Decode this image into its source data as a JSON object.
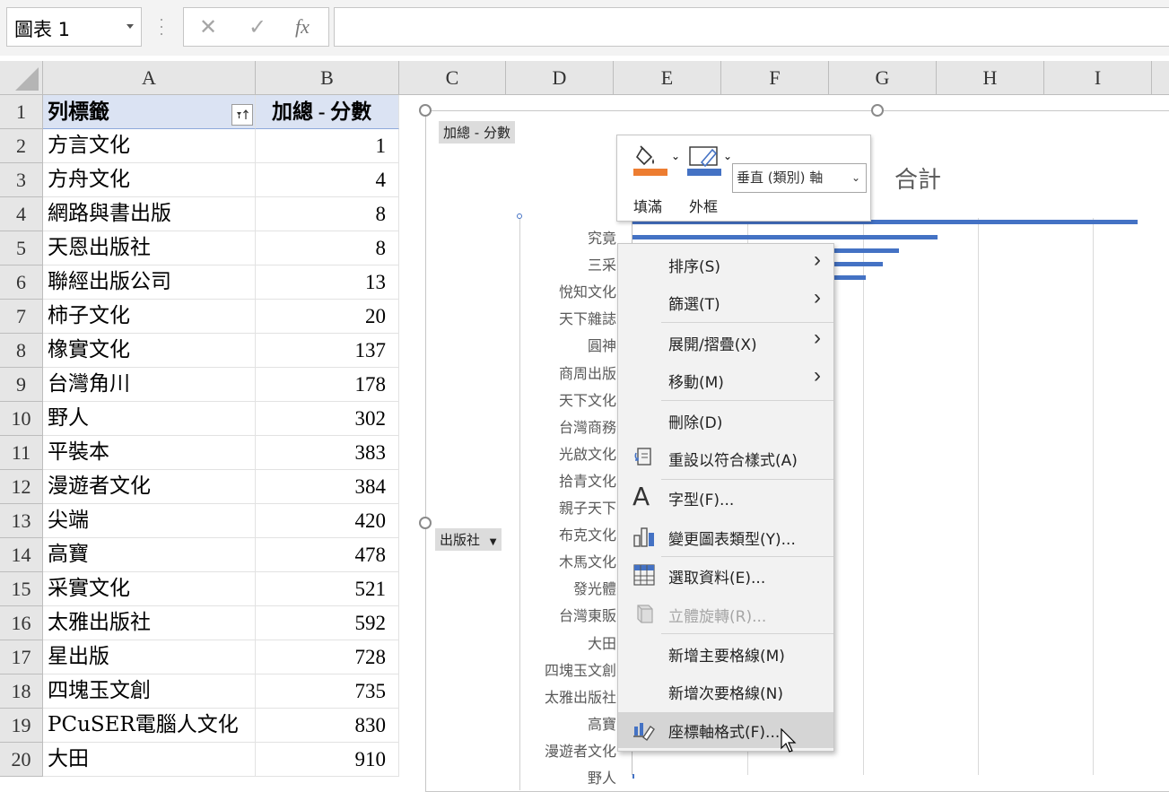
{
  "name_box": "圖表 1",
  "formula_icons": {
    "cancel": "✕",
    "enter": "✓",
    "fx": "fx"
  },
  "columns": [
    "A",
    "B",
    "C",
    "D",
    "E",
    "F",
    "G",
    "H",
    "I"
  ],
  "rows": [
    {
      "num": "1",
      "a": "列標籤",
      "b": "加總 - 分數"
    },
    {
      "num": "2",
      "a": "方言文化",
      "b": "1"
    },
    {
      "num": "3",
      "a": "方舟文化",
      "b": "4"
    },
    {
      "num": "4",
      "a": "網路與書出版",
      "b": "8"
    },
    {
      "num": "5",
      "a": "天恩出版社",
      "b": "8"
    },
    {
      "num": "6",
      "a": "聯經出版公司",
      "b": "13"
    },
    {
      "num": "7",
      "a": "柿子文化",
      "b": "20"
    },
    {
      "num": "8",
      "a": "橡實文化",
      "b": "137"
    },
    {
      "num": "9",
      "a": "台灣角川",
      "b": "178"
    },
    {
      "num": "10",
      "a": "野人",
      "b": "302"
    },
    {
      "num": "11",
      "a": "平裝本",
      "b": "383"
    },
    {
      "num": "12",
      "a": "漫遊者文化",
      "b": "384"
    },
    {
      "num": "13",
      "a": "尖端",
      "b": "420"
    },
    {
      "num": "14",
      "a": "高寶",
      "b": "478"
    },
    {
      "num": "15",
      "a": "采實文化",
      "b": "521"
    },
    {
      "num": "16",
      "a": "太雅出版社",
      "b": "592"
    },
    {
      "num": "17",
      "a": "星出版",
      "b": "728"
    },
    {
      "num": "18",
      "a": "四塊玉文創",
      "b": "735"
    },
    {
      "num": "19",
      "a": "PCuSER電腦人文化",
      "b": "830"
    },
    {
      "num": "20",
      "a": "大田",
      "b": "910"
    }
  ],
  "chart": {
    "value_field_button": "加總 - 分數",
    "axis_field_button": "出版社",
    "title": "合計",
    "category_labels": [
      "究竟",
      "三采",
      "悅知文化",
      "天下雜誌",
      "圓神",
      "商周出版",
      "天下文化",
      "台灣商務",
      "光啟文化",
      "拾青文化",
      "親子天下",
      "布克文化",
      "木馬文化",
      "發光體",
      "台灣東販",
      "大田",
      "四塊玉文創",
      "太雅出版社",
      "高寶",
      "漫遊者文化",
      "野人"
    ]
  },
  "chart_data": {
    "type": "bar",
    "orientation": "horizontal",
    "title": "合計",
    "categories": [
      "究竟",
      "三采",
      "悅知文化",
      "天下雜誌",
      "圓神",
      "商周出版",
      "天下文化",
      "台灣商務",
      "光啟文化",
      "拾青文化",
      "親子天下",
      "布克文化",
      "木馬文化",
      "發光體",
      "台灣東販",
      "大田",
      "四塊玉文創",
      "太雅出版社",
      "高寶",
      "漫遊者文化",
      "野人"
    ],
    "values": [
      4400,
      2660,
      2320,
      2180,
      2030,
      null,
      null,
      null,
      null,
      null,
      null,
      null,
      null,
      null,
      null,
      910,
      735,
      592,
      478,
      384,
      302
    ],
    "color": "#4472c4",
    "grid": true
  },
  "mini_toolbar": {
    "fill_label": "填滿",
    "outline_label": "外框",
    "element_select": "垂直 (類別) 軸",
    "fill_color": "#ed7d31",
    "outline_color": "#4472c4"
  },
  "context_menu": {
    "items": [
      {
        "label": "排序(S)",
        "submenu": true
      },
      {
        "label": "篩選(T)",
        "submenu": true
      },
      {
        "label": "展開/摺疊(X)",
        "submenu": true
      },
      {
        "label": "移動(M)",
        "submenu": true
      },
      {
        "label": "刪除(D)"
      },
      {
        "label": "重設以符合樣式(A)",
        "icon": "reset-style-icon"
      },
      {
        "label": "字型(F)...",
        "icon": "font-icon"
      },
      {
        "label": "變更圖表類型(Y)...",
        "icon": "chart-type-icon"
      },
      {
        "label": "選取資料(E)...",
        "icon": "select-data-icon"
      },
      {
        "label": "立體旋轉(R)...",
        "icon": "3d-rotation-icon",
        "disabled": true
      },
      {
        "label": "新增主要格線(M)"
      },
      {
        "label": "新增次要格線(N)"
      },
      {
        "label": "座標軸格式(F)...",
        "icon": "format-axis-icon",
        "highlighted": true
      }
    ]
  }
}
